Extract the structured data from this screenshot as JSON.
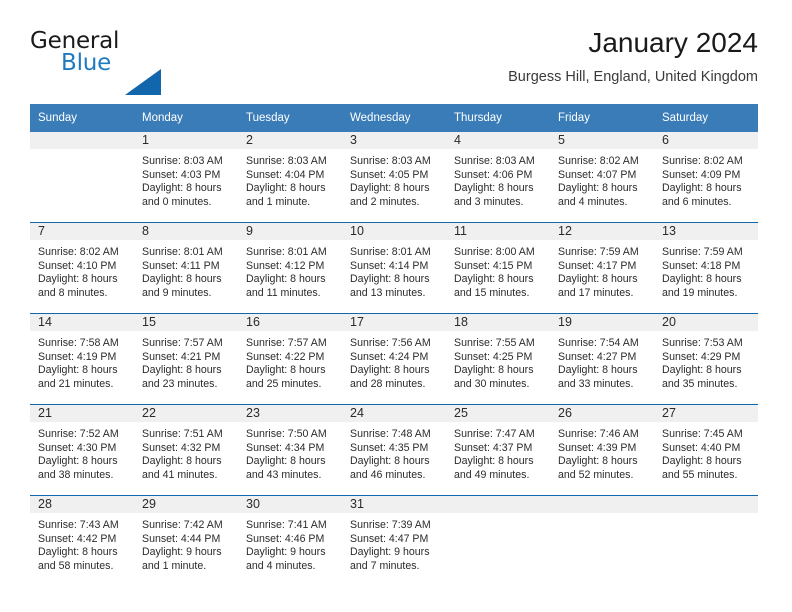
{
  "brand": {
    "name_top": "General",
    "name_bottom": "Blue",
    "triangle_icon": "triangle-logo-icon",
    "color_blue": "#1f7bc1",
    "color_triangle": "#1266ab"
  },
  "header": {
    "title": "January 2024",
    "subtitle": "Burgess Hill, England, United Kingdom"
  },
  "theme": {
    "header_bg": "#3a7cb8",
    "header_text": "#ffffff",
    "daynum_bg": "#f0f0f0",
    "row_border": "#1266ab"
  },
  "weekday_headers": [
    "Sunday",
    "Monday",
    "Tuesday",
    "Wednesday",
    "Thursday",
    "Friday",
    "Saturday"
  ],
  "weeks": [
    [
      {
        "day": "",
        "sunrise": "",
        "sunset": "",
        "daylight_line1": "",
        "daylight_line2": ""
      },
      {
        "day": "1",
        "sunrise": "Sunrise: 8:03 AM",
        "sunset": "Sunset: 4:03 PM",
        "daylight_line1": "Daylight: 8 hours",
        "daylight_line2": "and 0 minutes."
      },
      {
        "day": "2",
        "sunrise": "Sunrise: 8:03 AM",
        "sunset": "Sunset: 4:04 PM",
        "daylight_line1": "Daylight: 8 hours",
        "daylight_line2": "and 1 minute."
      },
      {
        "day": "3",
        "sunrise": "Sunrise: 8:03 AM",
        "sunset": "Sunset: 4:05 PM",
        "daylight_line1": "Daylight: 8 hours",
        "daylight_line2": "and 2 minutes."
      },
      {
        "day": "4",
        "sunrise": "Sunrise: 8:03 AM",
        "sunset": "Sunset: 4:06 PM",
        "daylight_line1": "Daylight: 8 hours",
        "daylight_line2": "and 3 minutes."
      },
      {
        "day": "5",
        "sunrise": "Sunrise: 8:02 AM",
        "sunset": "Sunset: 4:07 PM",
        "daylight_line1": "Daylight: 8 hours",
        "daylight_line2": "and 4 minutes."
      },
      {
        "day": "6",
        "sunrise": "Sunrise: 8:02 AM",
        "sunset": "Sunset: 4:09 PM",
        "daylight_line1": "Daylight: 8 hours",
        "daylight_line2": "and 6 minutes."
      }
    ],
    [
      {
        "day": "7",
        "sunrise": "Sunrise: 8:02 AM",
        "sunset": "Sunset: 4:10 PM",
        "daylight_line1": "Daylight: 8 hours",
        "daylight_line2": "and 8 minutes."
      },
      {
        "day": "8",
        "sunrise": "Sunrise: 8:01 AM",
        "sunset": "Sunset: 4:11 PM",
        "daylight_line1": "Daylight: 8 hours",
        "daylight_line2": "and 9 minutes."
      },
      {
        "day": "9",
        "sunrise": "Sunrise: 8:01 AM",
        "sunset": "Sunset: 4:12 PM",
        "daylight_line1": "Daylight: 8 hours",
        "daylight_line2": "and 11 minutes."
      },
      {
        "day": "10",
        "sunrise": "Sunrise: 8:01 AM",
        "sunset": "Sunset: 4:14 PM",
        "daylight_line1": "Daylight: 8 hours",
        "daylight_line2": "and 13 minutes."
      },
      {
        "day": "11",
        "sunrise": "Sunrise: 8:00 AM",
        "sunset": "Sunset: 4:15 PM",
        "daylight_line1": "Daylight: 8 hours",
        "daylight_line2": "and 15 minutes."
      },
      {
        "day": "12",
        "sunrise": "Sunrise: 7:59 AM",
        "sunset": "Sunset: 4:17 PM",
        "daylight_line1": "Daylight: 8 hours",
        "daylight_line2": "and 17 minutes."
      },
      {
        "day": "13",
        "sunrise": "Sunrise: 7:59 AM",
        "sunset": "Sunset: 4:18 PM",
        "daylight_line1": "Daylight: 8 hours",
        "daylight_line2": "and 19 minutes."
      }
    ],
    [
      {
        "day": "14",
        "sunrise": "Sunrise: 7:58 AM",
        "sunset": "Sunset: 4:19 PM",
        "daylight_line1": "Daylight: 8 hours",
        "daylight_line2": "and 21 minutes."
      },
      {
        "day": "15",
        "sunrise": "Sunrise: 7:57 AM",
        "sunset": "Sunset: 4:21 PM",
        "daylight_line1": "Daylight: 8 hours",
        "daylight_line2": "and 23 minutes."
      },
      {
        "day": "16",
        "sunrise": "Sunrise: 7:57 AM",
        "sunset": "Sunset: 4:22 PM",
        "daylight_line1": "Daylight: 8 hours",
        "daylight_line2": "and 25 minutes."
      },
      {
        "day": "17",
        "sunrise": "Sunrise: 7:56 AM",
        "sunset": "Sunset: 4:24 PM",
        "daylight_line1": "Daylight: 8 hours",
        "daylight_line2": "and 28 minutes."
      },
      {
        "day": "18",
        "sunrise": "Sunrise: 7:55 AM",
        "sunset": "Sunset: 4:25 PM",
        "daylight_line1": "Daylight: 8 hours",
        "daylight_line2": "and 30 minutes."
      },
      {
        "day": "19",
        "sunrise": "Sunrise: 7:54 AM",
        "sunset": "Sunset: 4:27 PM",
        "daylight_line1": "Daylight: 8 hours",
        "daylight_line2": "and 33 minutes."
      },
      {
        "day": "20",
        "sunrise": "Sunrise: 7:53 AM",
        "sunset": "Sunset: 4:29 PM",
        "daylight_line1": "Daylight: 8 hours",
        "daylight_line2": "and 35 minutes."
      }
    ],
    [
      {
        "day": "21",
        "sunrise": "Sunrise: 7:52 AM",
        "sunset": "Sunset: 4:30 PM",
        "daylight_line1": "Daylight: 8 hours",
        "daylight_line2": "and 38 minutes."
      },
      {
        "day": "22",
        "sunrise": "Sunrise: 7:51 AM",
        "sunset": "Sunset: 4:32 PM",
        "daylight_line1": "Daylight: 8 hours",
        "daylight_line2": "and 41 minutes."
      },
      {
        "day": "23",
        "sunrise": "Sunrise: 7:50 AM",
        "sunset": "Sunset: 4:34 PM",
        "daylight_line1": "Daylight: 8 hours",
        "daylight_line2": "and 43 minutes."
      },
      {
        "day": "24",
        "sunrise": "Sunrise: 7:48 AM",
        "sunset": "Sunset: 4:35 PM",
        "daylight_line1": "Daylight: 8 hours",
        "daylight_line2": "and 46 minutes."
      },
      {
        "day": "25",
        "sunrise": "Sunrise: 7:47 AM",
        "sunset": "Sunset: 4:37 PM",
        "daylight_line1": "Daylight: 8 hours",
        "daylight_line2": "and 49 minutes."
      },
      {
        "day": "26",
        "sunrise": "Sunrise: 7:46 AM",
        "sunset": "Sunset: 4:39 PM",
        "daylight_line1": "Daylight: 8 hours",
        "daylight_line2": "and 52 minutes."
      },
      {
        "day": "27",
        "sunrise": "Sunrise: 7:45 AM",
        "sunset": "Sunset: 4:40 PM",
        "daylight_line1": "Daylight: 8 hours",
        "daylight_line2": "and 55 minutes."
      }
    ],
    [
      {
        "day": "28",
        "sunrise": "Sunrise: 7:43 AM",
        "sunset": "Sunset: 4:42 PM",
        "daylight_line1": "Daylight: 8 hours",
        "daylight_line2": "and 58 minutes."
      },
      {
        "day": "29",
        "sunrise": "Sunrise: 7:42 AM",
        "sunset": "Sunset: 4:44 PM",
        "daylight_line1": "Daylight: 9 hours",
        "daylight_line2": "and 1 minute."
      },
      {
        "day": "30",
        "sunrise": "Sunrise: 7:41 AM",
        "sunset": "Sunset: 4:46 PM",
        "daylight_line1": "Daylight: 9 hours",
        "daylight_line2": "and 4 minutes."
      },
      {
        "day": "31",
        "sunrise": "Sunrise: 7:39 AM",
        "sunset": "Sunset: 4:47 PM",
        "daylight_line1": "Daylight: 9 hours",
        "daylight_line2": "and 7 minutes."
      },
      {
        "day": "",
        "sunrise": "",
        "sunset": "",
        "daylight_line1": "",
        "daylight_line2": ""
      },
      {
        "day": "",
        "sunrise": "",
        "sunset": "",
        "daylight_line1": "",
        "daylight_line2": ""
      },
      {
        "day": "",
        "sunrise": "",
        "sunset": "",
        "daylight_line1": "",
        "daylight_line2": ""
      }
    ]
  ]
}
